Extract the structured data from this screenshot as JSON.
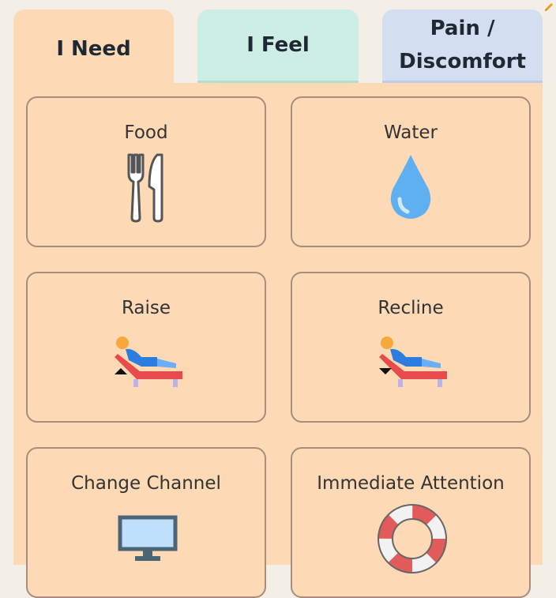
{
  "tabs": [
    {
      "label": "I Need"
    },
    {
      "label": "I Feel"
    },
    {
      "label": "Pain / Discomfort"
    }
  ],
  "cards": [
    {
      "label": "Food",
      "icon": "fork-knife-icon"
    },
    {
      "label": "Water",
      "icon": "water-drop-icon"
    },
    {
      "label": "Raise",
      "icon": "raise-recliner-icon"
    },
    {
      "label": "Recline",
      "icon": "recline-recliner-icon"
    },
    {
      "label": "Change Channel",
      "icon": "tv-icon"
    },
    {
      "label": "Immediate Attention",
      "icon": "lifebuoy-icon"
    }
  ],
  "colors": {
    "active_tab": "#fdd9b6",
    "feel_tab": "#cdeee4",
    "pain_tab": "#d3def0",
    "card_border": "#a88d7c",
    "water": "#5fb0f0",
    "chair": "#e84b4b",
    "person": "#2d7de0"
  }
}
